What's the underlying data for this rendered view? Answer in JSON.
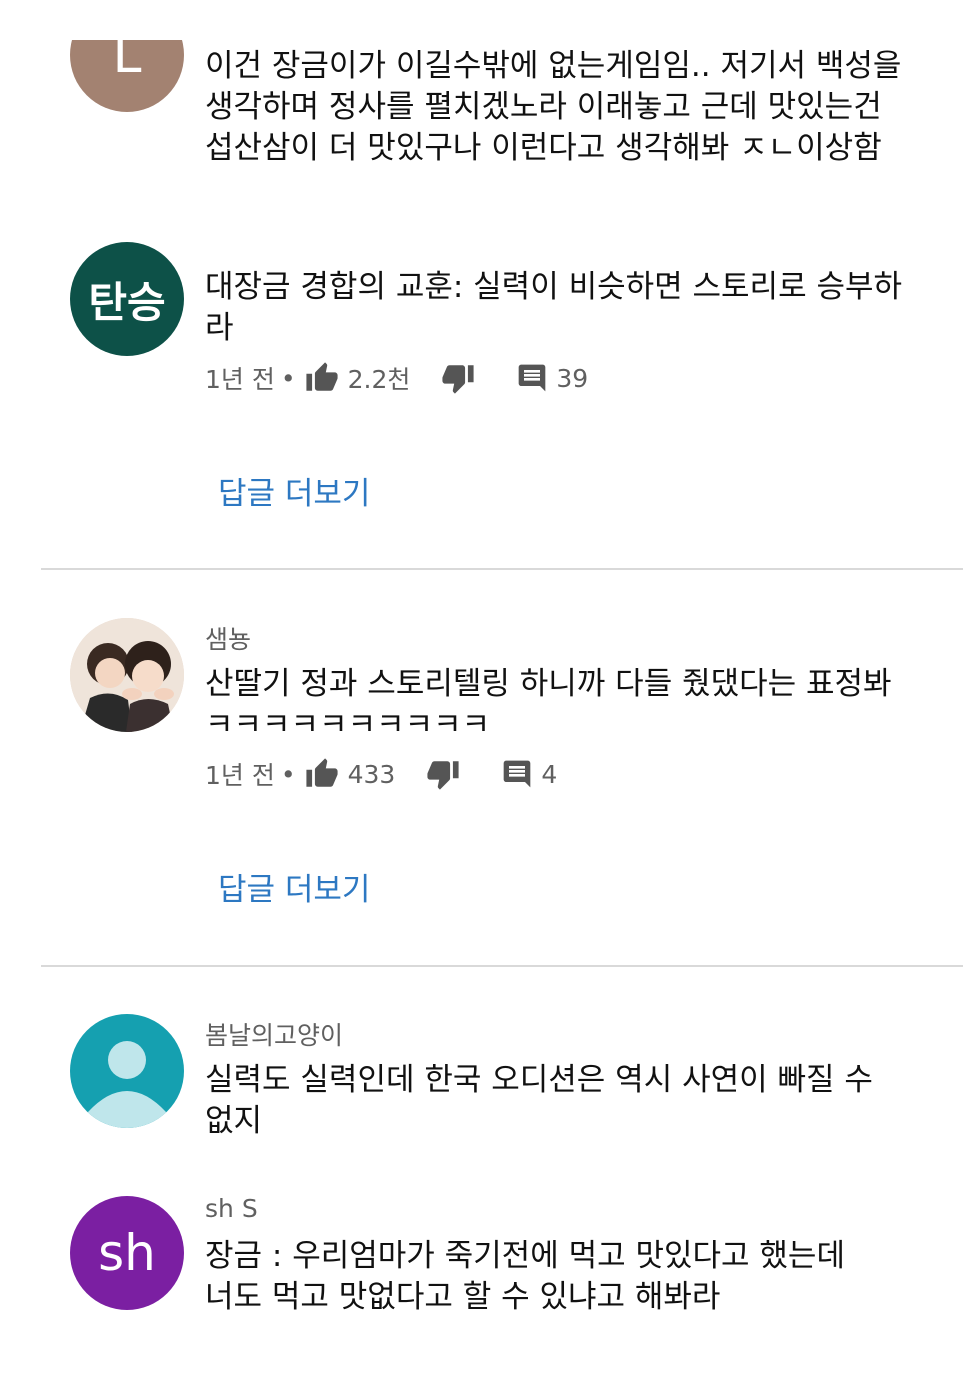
{
  "colors": {
    "link": "#2d78c2",
    "meta": "#606060",
    "divider": "#d9d9d9"
  },
  "comments": [
    {
      "avatar_letter": "L",
      "avatar_color": "#a38271",
      "text_lines": [
        "이건 장금이가 이길수밖에 없는게임임.. 저기서 백성을",
        "생각하며 정사를 펼치겠노라 이래놓고 근데 맛있는건",
        "섭산삼이 더 맛있구나 이런다고 생각해봐 ㅈㄴ이상함"
      ]
    },
    {
      "avatar_letter": "탄승",
      "avatar_color": "#0d5148",
      "text_lines": [
        "대장금 경합의 교훈: 실력이 비슷하면 스토리로 승부하",
        "라"
      ],
      "time": "1년 전",
      "dot": "•",
      "likes": "2.2천",
      "replies": "39",
      "more_replies": "답글 더보기"
    },
    {
      "author": "샘뇽",
      "text_lines": [
        "산딸기 정과 스토리텔링 하니까 다들 줬댔다는 표정봐",
        "ㅋㅋㅋㅋㅋㅋㅋㅋㅋㅋ"
      ],
      "time": "1년 전",
      "dot": "•",
      "likes": "433",
      "replies": "4",
      "more_replies": "답글 더보기"
    },
    {
      "author": "봄날의고양이",
      "avatar_color": "#15a0b0",
      "text_lines": [
        "실력도 실력인데 한국 오디션은 역시 사연이 빠질 수",
        "없지"
      ]
    },
    {
      "author": "sh S",
      "avatar_letter": "sh",
      "avatar_color": "#7b1fa2",
      "text_lines": [
        "장금 : 우리엄마가 죽기전에 먹고 맛있다고 했는데",
        "너도 먹고 맛없다고 할 수 있냐고 해봐라"
      ]
    }
  ]
}
